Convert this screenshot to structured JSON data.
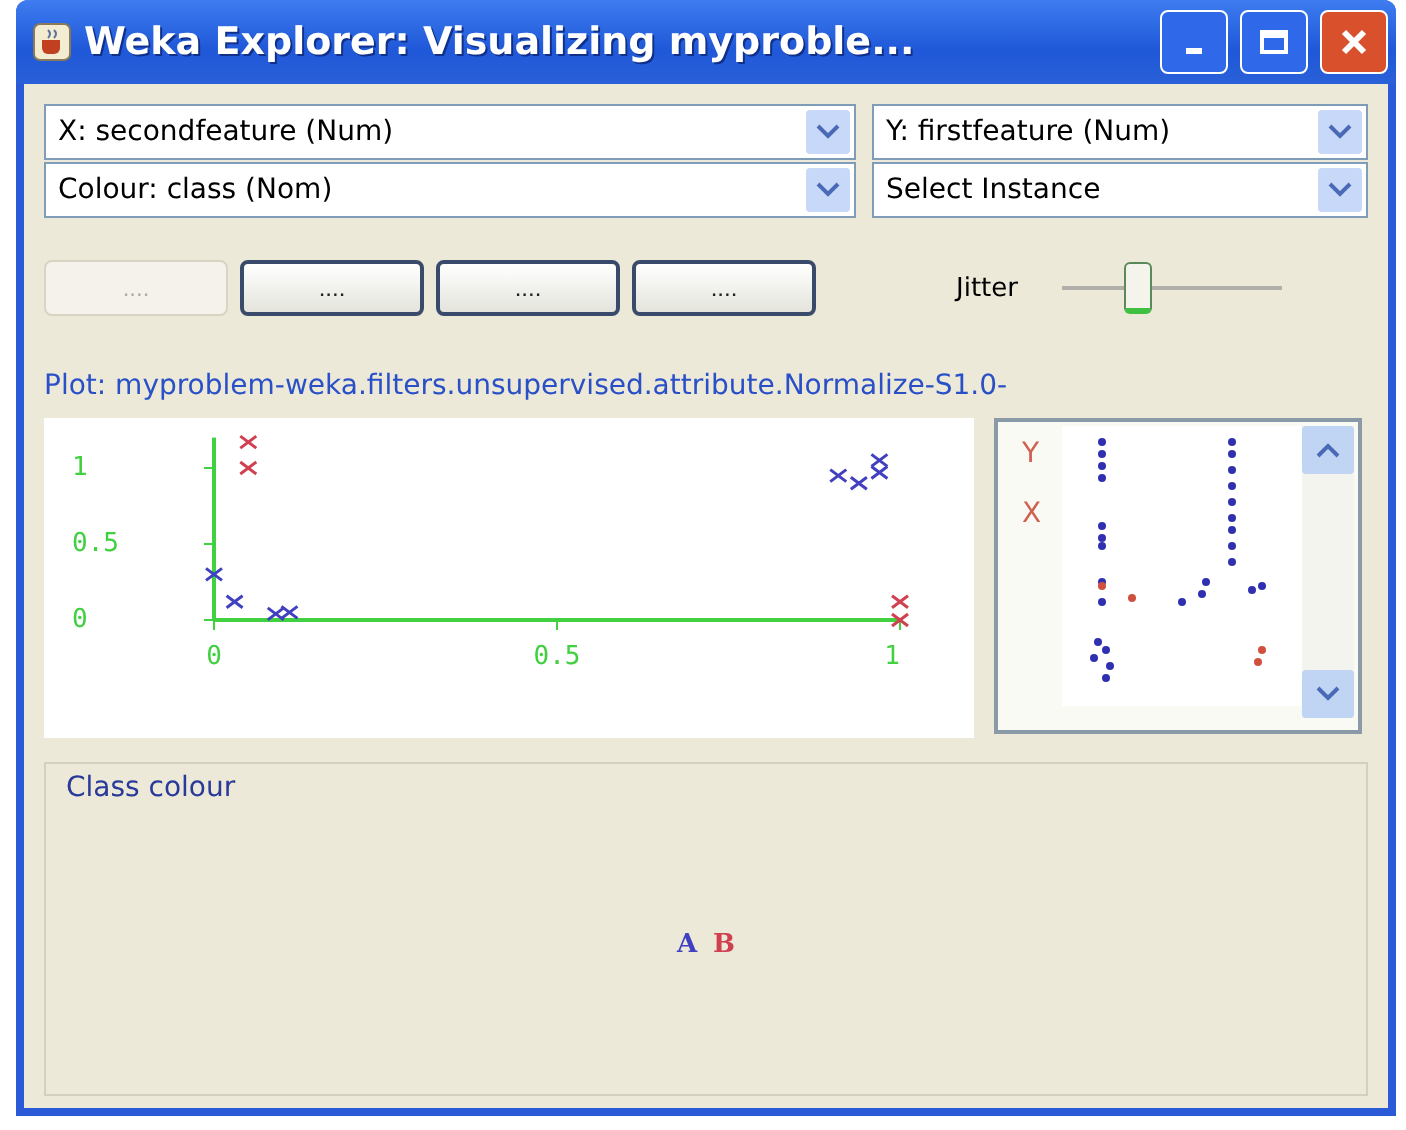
{
  "window": {
    "title": "Weka Explorer: Visualizing myproble..."
  },
  "selectors": [
    {
      "label": "X: secondfeature (Num)"
    },
    {
      "label": "Y: firstfeature (Num)"
    },
    {
      "label": "Colour: class (Nom)"
    },
    {
      "label": "Select Instance"
    }
  ],
  "buttons": [
    {
      "label": "....",
      "disabled": true
    },
    {
      "label": "....",
      "disabled": false
    },
    {
      "label": "....",
      "disabled": false
    },
    {
      "label": "....",
      "disabled": false
    }
  ],
  "jitter": {
    "label": "Jitter",
    "level": 0.35
  },
  "plot": {
    "title": "Plot: myproblem-weka.filters.unsupervised.attribute.Normalize-S1.0-",
    "chart_data": {
      "type": "scatter",
      "xlim": [
        0,
        1
      ],
      "ylim": [
        0,
        1.2
      ],
      "xticks": [
        0,
        0.5,
        1
      ],
      "yticks": [
        0,
        0.5,
        1
      ],
      "series": [
        {
          "name": "A",
          "color": "#4040c0",
          "x": [
            0,
            0.03,
            0.09,
            0.11,
            0.91,
            0.94,
            0.97,
            0.97
          ],
          "values": [
            0.3,
            0.12,
            0.04,
            0.05,
            0.95,
            0.9,
            1.05,
            0.97
          ]
        },
        {
          "name": "B",
          "color": "#d04050",
          "x": [
            0.05,
            0.05,
            1,
            1
          ],
          "values": [
            1.17,
            1.0,
            0.12,
            0
          ]
        }
      ]
    }
  },
  "attribute_panel": {
    "labels": [
      {
        "text": "Y"
      },
      {
        "text": "X"
      }
    ]
  },
  "class_colour": {
    "title": "Class colour"
  }
}
